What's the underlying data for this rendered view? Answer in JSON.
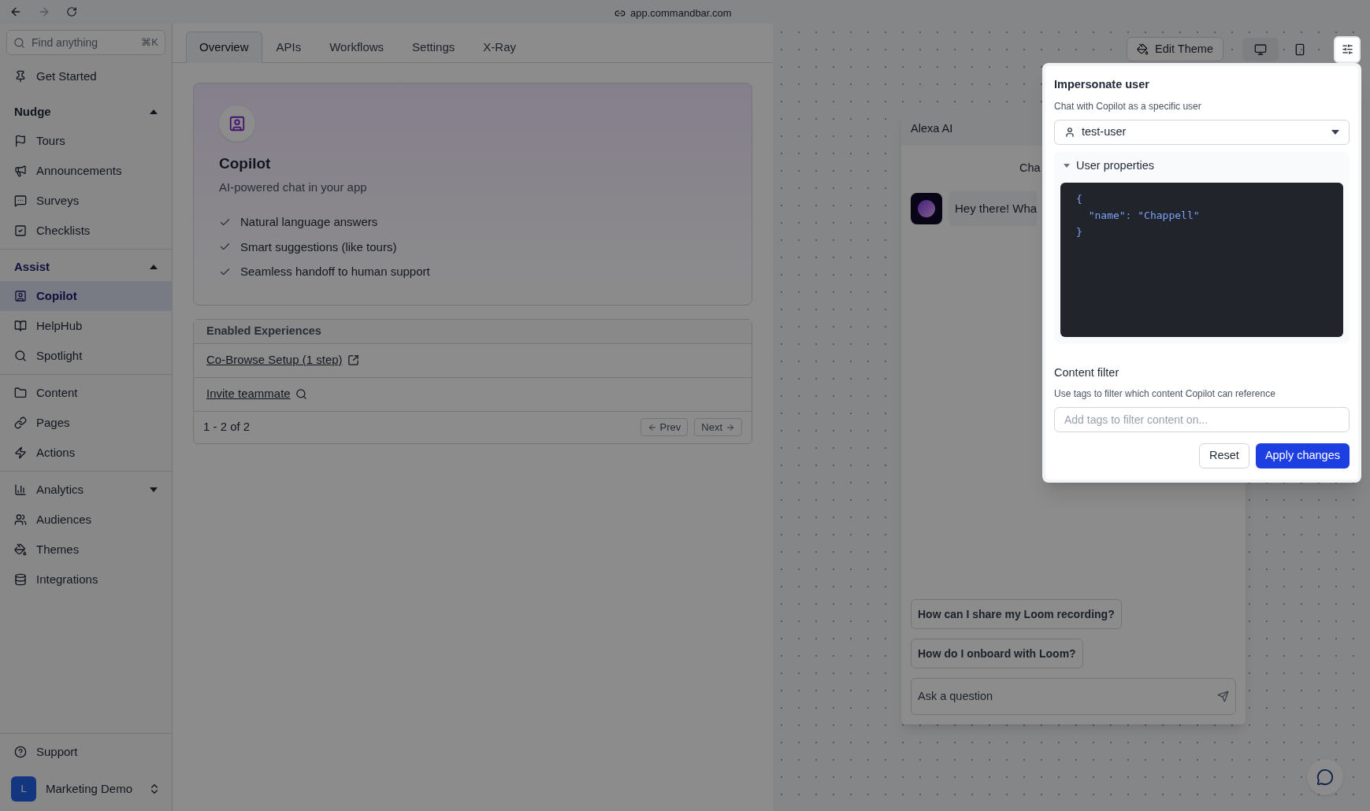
{
  "browser": {
    "url": "app.commandbar.com"
  },
  "sidebar": {
    "search": {
      "placeholder": "Find anything",
      "shortcut": "⌘K"
    },
    "groups": [
      {
        "items": [
          {
            "label": "Get Started",
            "selected": false
          }
        ]
      },
      {
        "title": "Nudge",
        "expanded": true,
        "items": [
          {
            "label": "Tours",
            "selected": false
          },
          {
            "label": "Announcements",
            "selected": false
          },
          {
            "label": "Surveys",
            "selected": false
          },
          {
            "label": "Checklists",
            "selected": false
          }
        ]
      },
      {
        "title": "Assist",
        "expanded": true,
        "items": [
          {
            "label": "Copilot",
            "selected": true
          },
          {
            "label": "HelpHub",
            "selected": false
          },
          {
            "label": "Spotlight",
            "selected": false
          }
        ]
      },
      {
        "items": [
          {
            "label": "Content",
            "selected": false
          },
          {
            "label": "Pages",
            "selected": false
          },
          {
            "label": "Actions",
            "selected": false
          }
        ]
      },
      {
        "items": [
          {
            "label": "Analytics",
            "selected": false,
            "kind": "group",
            "expanded": false
          },
          {
            "label": "Audiences",
            "selected": false,
            "kind": "link"
          },
          {
            "label": "Themes",
            "selected": false,
            "kind": "link"
          },
          {
            "label": "Integrations",
            "selected": false,
            "kind": "link"
          }
        ]
      }
    ],
    "support": "Support",
    "workspace": {
      "initial": "L",
      "name": "Marketing Demo"
    }
  },
  "tabs": [
    {
      "label": "Overview",
      "selected": true
    },
    {
      "label": "APIs",
      "selected": false
    },
    {
      "label": "Workflows",
      "selected": false
    },
    {
      "label": "Settings",
      "selected": false
    },
    {
      "label": "X-Ray",
      "selected": false
    }
  ],
  "hero": {
    "title": "Copilot",
    "subtitle": "AI-powered chat in your app",
    "features": [
      "Natural language answers",
      "Smart suggestions (like tours)",
      "Seamless handoff to human support"
    ]
  },
  "experiences": {
    "header": "Enabled Experiences",
    "rows": [
      "Co-Browse Setup (1 step)",
      "Invite teammate"
    ],
    "range": "1 - 2 of 2",
    "prev": "Prev",
    "next": "Next"
  },
  "toolbar": {
    "edit_theme": "Edit Theme",
    "devices": [
      {
        "selected": true
      },
      {
        "selected": false
      }
    ]
  },
  "chat": {
    "title": "Alexa AI",
    "greeting": "Cha",
    "message": "Hey there! Wha",
    "suggestions": [
      "How can I share my Loom recording?",
      "How do I onboard with Loom?"
    ],
    "input_placeholder": "Ask a question"
  },
  "popover": {
    "title": "Impersonate user",
    "subtitle": "Chat with Copilot as a specific user",
    "user": "test-user",
    "properties": {
      "title": "User properties",
      "expanded": true,
      "code": [
        "{",
        "  \"name\": \"Chappell\"",
        "}"
      ]
    },
    "filter_title": "Content filter",
    "filter_subtitle": "Use tags to filter which content Copilot can reference",
    "filter_placeholder": "Add tags to filter content on...",
    "reset": "Reset",
    "apply": "Apply changes"
  }
}
